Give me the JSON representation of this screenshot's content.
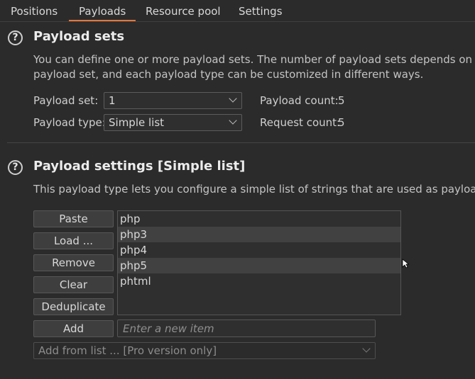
{
  "tabs": [
    {
      "label": "Positions"
    },
    {
      "label": "Payloads",
      "active": true
    },
    {
      "label": "Resource pool"
    },
    {
      "label": "Settings"
    }
  ],
  "accent_color": "#e5773c",
  "payload_sets": {
    "help_icon": "?",
    "title": "Payload sets",
    "description_line1": "You can define one or more payload sets. The number of payload sets depends on the att",
    "description_line2": "payload set, and each payload type can be customized in different ways.",
    "payload_set_label": "Payload set:",
    "payload_set_value": "1",
    "payload_type_label": "Payload type:",
    "payload_type_value": "Simple list",
    "payload_count_label": "Payload count:",
    "payload_count_value": "5",
    "request_count_label": "Request count:",
    "request_count_value": "5"
  },
  "payload_settings": {
    "help_icon": "?",
    "title": "Payload settings [Simple list]",
    "description": "This payload type lets you configure a simple list of strings that are used as payloads.",
    "buttons": {
      "paste": "Paste",
      "load": "Load ...",
      "remove": "Remove",
      "clear": "Clear",
      "deduplicate": "Deduplicate",
      "add": "Add"
    },
    "items": [
      "php",
      "php3",
      "php4",
      "php5",
      "phtml"
    ],
    "new_item_placeholder": "Enter a new item",
    "add_from_list": "Add from list ... [Pro version only]"
  }
}
